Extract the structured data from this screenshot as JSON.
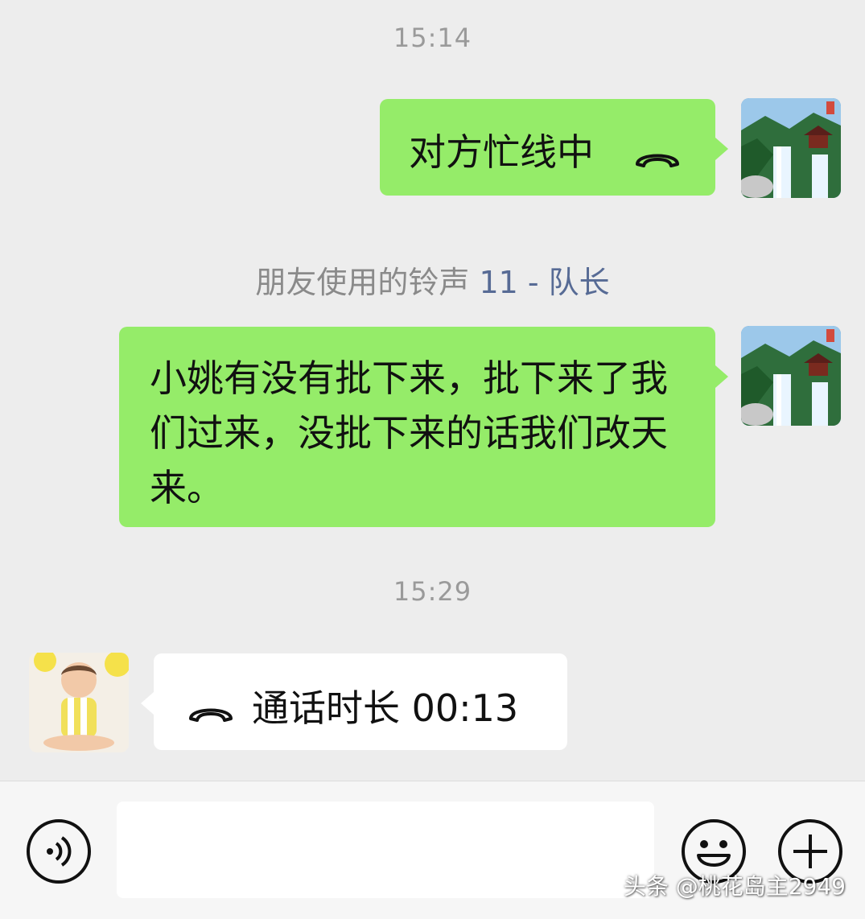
{
  "messages": {
    "timestamp_1": "15:14",
    "call_status_1": "对方忙线中",
    "system_note_prefix": "朋友使用的铃声",
    "system_note_link": "11 - 队长",
    "message_2": "小姚有没有批下来，批下来了我们过来，没批下来的话我们改天来。",
    "timestamp_2": "15:29",
    "call_duration": "通话时长 00:13"
  },
  "input_bar": {
    "voice_icon": "voice-icon",
    "emoji_icon": "smiley-icon",
    "plus_icon": "plus-icon"
  },
  "watermark": "头条 @桃花岛主2949",
  "colors": {
    "background": "#ededed",
    "outgoing_bubble": "#95ec69",
    "incoming_bubble": "#ffffff",
    "link": "#576b95",
    "timestamp": "#9a9a9a"
  }
}
